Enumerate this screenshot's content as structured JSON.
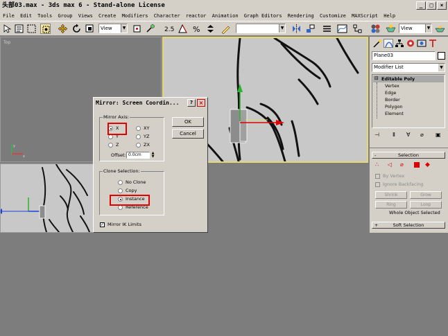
{
  "window": {
    "title": "头部03.max - 3ds max 6 - Stand-alone License"
  },
  "menu": [
    "File",
    "Edit",
    "Tools",
    "Group",
    "Views",
    "Create",
    "Modifiers",
    "Character",
    "reactor",
    "Animation",
    "Graph Editors",
    "Rendering",
    "Customize",
    "MAXScript",
    "Help"
  ],
  "toolbar": {
    "view_select": "View",
    "view_select_right": "View"
  },
  "viewports": {
    "top_label": "Top"
  },
  "command_panel": {
    "object_name": "Plane03",
    "modifier_list": "Modifier List",
    "stack": {
      "root": "Editable Poly",
      "subobjects": [
        "Vertex",
        "Edge",
        "Border",
        "Polygon",
        "Element"
      ]
    },
    "selection_rollout": {
      "title": "Selection",
      "by_vertex": "By Vertex",
      "ignore_backfacing": "Ignore Backfacing",
      "shrink": "Shrink",
      "grow": "Grow",
      "ring": "Ring",
      "loop": "Loop",
      "status": "Whole Object Selected"
    },
    "soft_selection_title": "Soft Selection"
  },
  "mirror_dialog": {
    "title": "Mirror: Screen Coordin...",
    "help": "?",
    "close": "×",
    "mirror_axis_label": "Mirror Axis:",
    "axes": [
      "X",
      "Y",
      "Z",
      "XY",
      "YZ",
      "ZX"
    ],
    "selected_axis": "X",
    "offset_label": "Offset:",
    "offset_value": "0.0cm",
    "ok": "OK",
    "cancel": "Cancel",
    "clone_label": "Clone Selection:",
    "clone_options": [
      "No Clone",
      "Copy",
      "Instance",
      "Reference"
    ],
    "selected_clone": "Instance",
    "mirror_ik": "Mirror IK Limits"
  },
  "colors": {
    "ui_gray": "#d4d0c8",
    "viewport_gray": "#7b7b7b",
    "active_viewport_border": "#e8d870",
    "highlight_red": "#e00000"
  }
}
